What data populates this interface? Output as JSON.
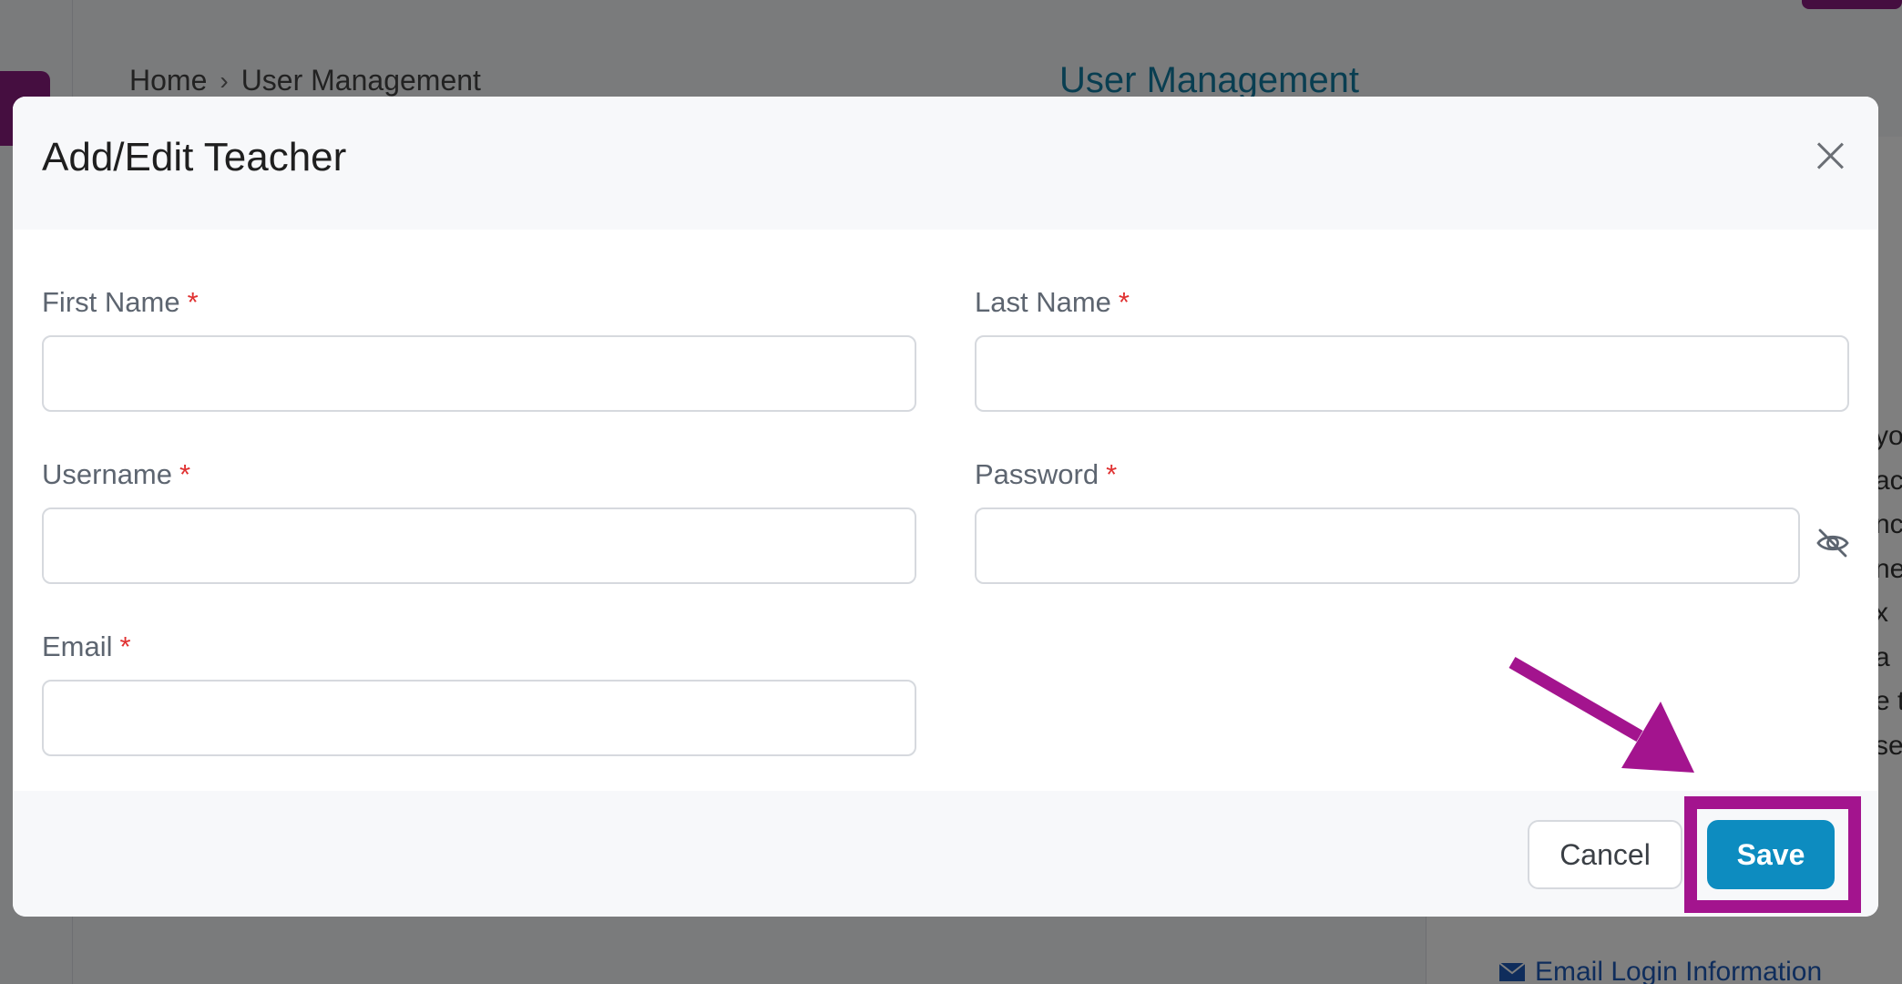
{
  "background": {
    "breadcrumb": {
      "home": "Home",
      "separator": "›",
      "current": "User Management"
    },
    "page_title": "User Management",
    "side_text_fragments": [
      "yo",
      "ac",
      "nc",
      "ne",
      "x a",
      "e t",
      "se"
    ],
    "email_link": "Email Login Information"
  },
  "modal": {
    "title": "Add/Edit Teacher",
    "fields": {
      "first_name": {
        "label": "First Name",
        "required": "*",
        "value": ""
      },
      "last_name": {
        "label": "Last Name",
        "required": "*",
        "value": ""
      },
      "username": {
        "label": "Username",
        "required": "*",
        "value": ""
      },
      "password": {
        "label": "Password",
        "required": "*",
        "value": ""
      },
      "email": {
        "label": "Email",
        "required": "*",
        "value": ""
      }
    },
    "buttons": {
      "cancel": "Cancel",
      "save": "Save"
    }
  },
  "icons": {
    "close": "close-icon",
    "password_toggle": "eye-slash-icon",
    "chevron": "chevron-right-icon",
    "email": "envelope-icon"
  },
  "colors": {
    "accent": "#0d8cc0",
    "title_blue": "#127da3",
    "annotation": "#a3148e",
    "required": "#e03131"
  }
}
